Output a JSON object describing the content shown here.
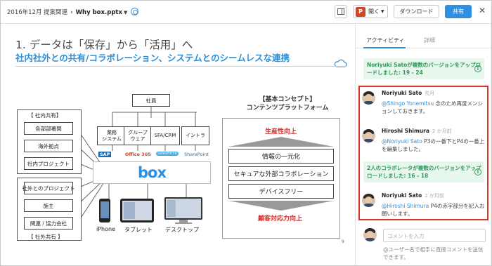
{
  "breadcrumb": {
    "parent": "2016年12月 提案関連",
    "file": "Why box.pptx"
  },
  "toolbar": {
    "open_label": "開く",
    "open_app_icon": "P",
    "download_label": "ダウンロード",
    "share_label": "共有",
    "close_glyph": "✕"
  },
  "slide": {
    "title": "1. データは「保存」から「活用」へ",
    "subtitle": "社内社外との共有/コラボレーション、システムとのシームレスな連携",
    "internal_group_title": "【 社内共有】",
    "internal_items": [
      "各部部署間",
      "海外拠点",
      "社内プロジェクト"
    ],
    "external_items": [
      "社外とのプロジェクト",
      "施主",
      "関連 / 協力会社"
    ],
    "external_group_title": "【 社外共有 】",
    "employee_label": "社員",
    "systems": [
      "業務\nシステム",
      "グループ\nウェア",
      "SFA/CRM",
      "イントラ"
    ],
    "app_logos": [
      "SAP",
      "Office 365",
      "salesforce",
      "SharePoint"
    ],
    "box_logo": "box",
    "devices": [
      "iPhone",
      "タブレット",
      "デスクトップ"
    ],
    "concept_title": "【基本コンセプト】\nコンテンツプラットフォーム",
    "concept_top": "生産性向上",
    "concept_bars": [
      "情報の一元化",
      "セキュアな外部コラボレーション",
      "デバイスフリー"
    ],
    "concept_bottom": "顧客対応力向上",
    "page_number": "9"
  },
  "panel": {
    "tabs": [
      "アクティビティ",
      "詳細"
    ],
    "notice_1": "Noriyuki Satoが複数のバージョンをアップロードしました: 19 - 24",
    "comments": [
      {
        "name": "Noriyuki Sato",
        "time": "先月",
        "mention": "@Shingo Yonemitsu",
        "text": " 念のため再度メンションしておきます。"
      },
      {
        "name": "Hiroshi Shimura",
        "time": "2 か月前",
        "mention": "@Noriyuki Sato",
        "text": " P3の一番下とP4の一番上を編集しました。"
      },
      {
        "name": "Noriyuki Sato",
        "time": "2 か月前",
        "mention": "@Hiroshi Shimura",
        "text": " P4の赤字部分を記入お願いします。"
      }
    ],
    "notice_2": "2人のコラボレータが複数のバージョンをアップロードしました: 16 - 18",
    "comment_placeholder": "コメントを入力",
    "comment_help": "@ユーザー名で相手に直接コメントを送信できます。"
  },
  "colors": {
    "accent": "#2f8fe0",
    "success_text": "#2d9b57",
    "success_bg": "#e8f7ee",
    "highlight_frame": "#d9342b",
    "slide_red": "#d0312d"
  }
}
